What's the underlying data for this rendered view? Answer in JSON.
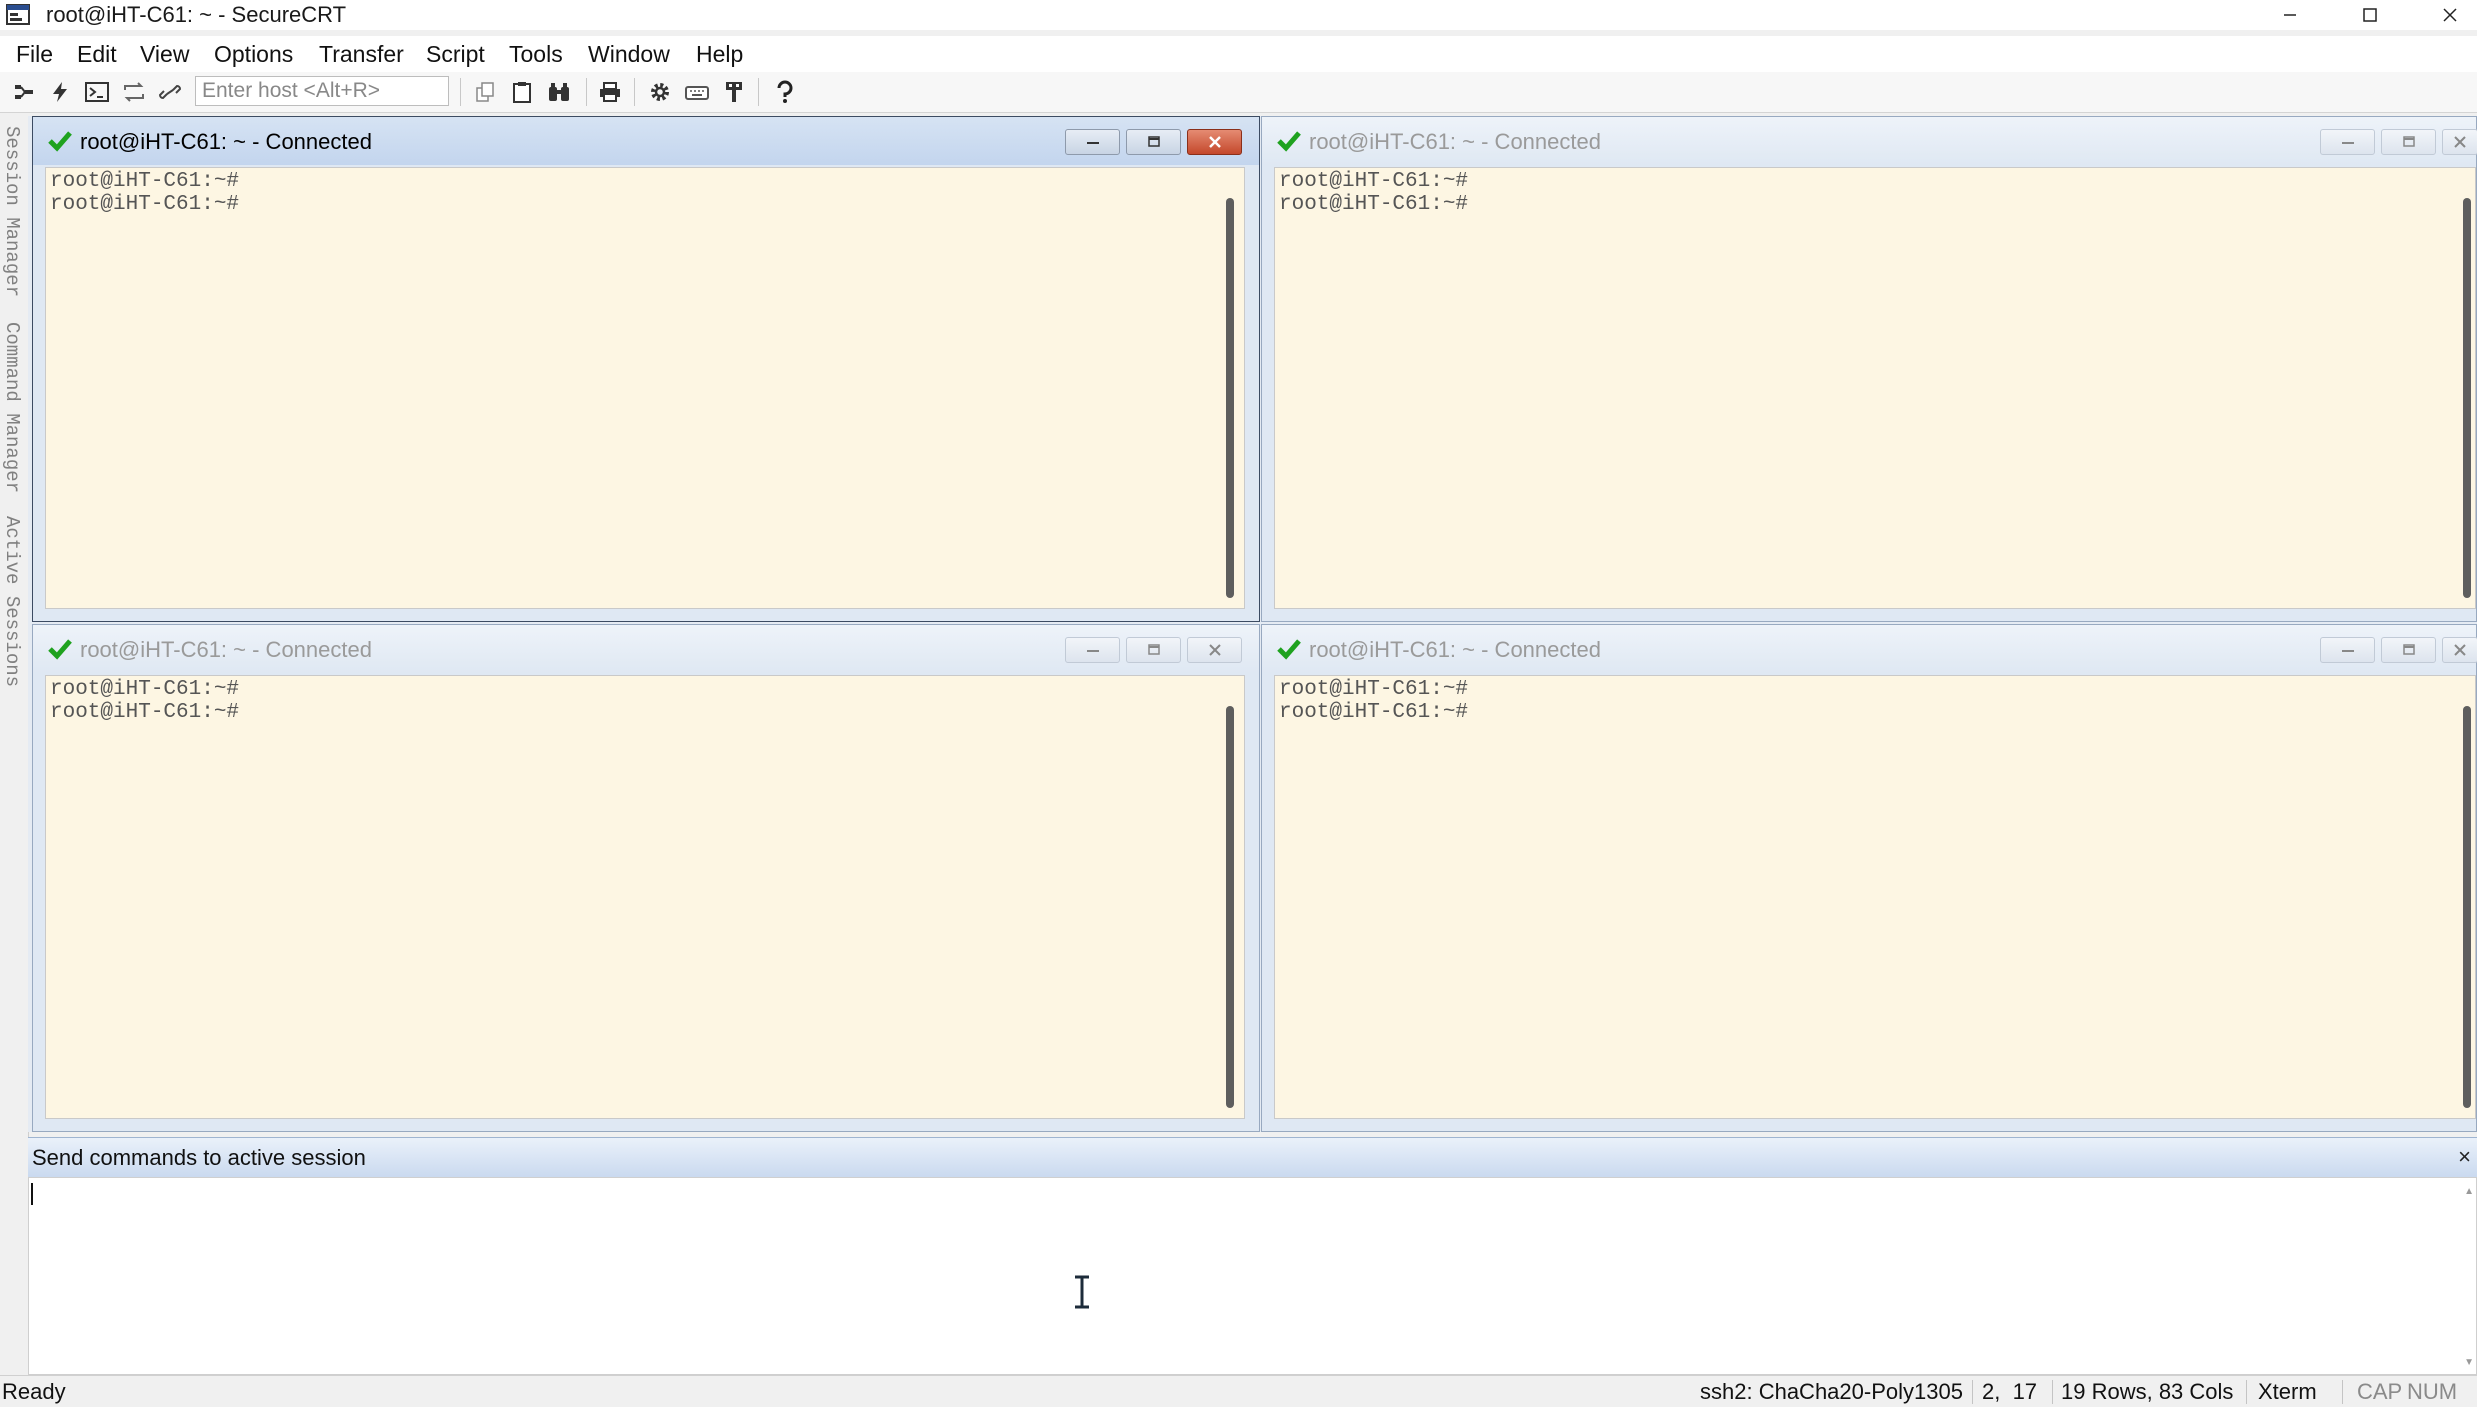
{
  "window": {
    "title": "root@iHT-C61: ~ - SecureCRT"
  },
  "menu": [
    "File",
    "Edit",
    "View",
    "Options",
    "Transfer",
    "Script",
    "Tools",
    "Window",
    "Help"
  ],
  "toolbar": {
    "host_placeholder": "Enter host <Alt+R>",
    "icons": [
      "connect-in-tab-icon",
      "quick-connect-icon",
      "connect-shell-icon",
      "reconnect-icon",
      "disconnect-icon",
      "copy-icon",
      "paste-icon",
      "find-icon",
      "print-icon",
      "settings-icon",
      "keymap-icon",
      "sftp-icon",
      "help-icon"
    ]
  },
  "side_tabs": [
    "Session Manager",
    "Command Manager",
    "Active Sessions"
  ],
  "panes": [
    {
      "title": "root@iHT-C61: ~ - Connected",
      "active": true,
      "lines": [
        "root@iHT-C61:~#",
        "root@iHT-C61:~#"
      ]
    },
    {
      "title": "root@iHT-C61: ~ - Connected",
      "active": false,
      "lines": [
        "root@iHT-C61:~#",
        "root@iHT-C61:~#"
      ]
    },
    {
      "title": "root@iHT-C61: ~ - Connected",
      "active": false,
      "lines": [
        "root@iHT-C61:~#",
        "root@iHT-C61:~#"
      ]
    },
    {
      "title": "root@iHT-C61: ~ - Connected",
      "active": false,
      "lines": [
        "root@iHT-C61:~#",
        "root@iHT-C61:~#"
      ]
    }
  ],
  "command_window": {
    "title": "Send commands to active session",
    "close": "×",
    "value": ""
  },
  "status": {
    "ready": "Ready",
    "cipher": "ssh2: ChaCha20-Poly1305",
    "cursor": "2,  17",
    "size": "19 Rows, 83 Cols",
    "terminal": "Xterm",
    "cap": "CAP",
    "num": "NUM"
  },
  "colors": {
    "terminal_bg": "#fdf6e3",
    "terminal_text": "#555555",
    "check_green": "#1fa21f",
    "active_close": "#c4482c"
  }
}
